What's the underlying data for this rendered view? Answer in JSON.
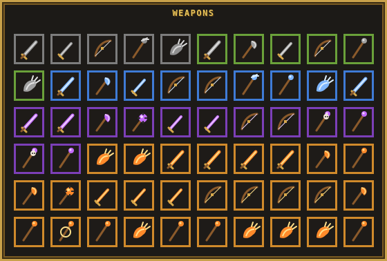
{
  "title": "WEAPONS",
  "rarity_colors": {
    "common": "#7d7d7d",
    "uncommon": "#6aa13a",
    "rare": "#3f7bd6",
    "epic": "#7c3fb8",
    "legendary": "#d08a2b"
  },
  "rows": [
    [
      "gray-sword-icon",
      "gray-dagger-icon",
      "gray-bow-icon",
      "gray-trident-icon",
      "gray-gauntlet-icon",
      "green-sword-icon",
      "green-axe-icon",
      "green-dagger-icon",
      "green-bow-icon",
      "green-staff-icon"
    ],
    [
      "green-claw-gauntlet-icon",
      "blue-sword-icon",
      "blue-halberd-icon",
      "blue-dagger-icon",
      "blue-bow-icon",
      "blue-crossbow-icon",
      "blue-trident-icon",
      "blue-staff-icon",
      "blue-gauntlet-icon",
      "blue-sword-icon"
    ],
    [
      "purple-sword-icon",
      "purple-sword-icon",
      "purple-axe-icon",
      "purple-mace-icon",
      "purple-dagger-icon",
      "purple-scimitar-icon",
      "purple-bow-icon",
      "purple-bow-icon",
      "purple-skull-staff-icon",
      "purple-staff-icon"
    ],
    [
      "purple-skull-staff-icon",
      "purple-staff-icon",
      "orange-gauntlet-icon",
      "orange-gauntlet-icon",
      "orange-sword-icon",
      "orange-sword-icon",
      "orange-sword-icon",
      "orange-sword-icon",
      "orange-axe-icon",
      "orange-staff-icon"
    ],
    [
      "orange-axe-icon",
      "orange-flail-icon",
      "orange-scimitar-icon",
      "orange-scimitar-icon",
      "orange-dagger-icon",
      "orange-bow-icon",
      "orange-bow-icon",
      "orange-bow-icon",
      "orange-bow-icon",
      "orange-axe-icon"
    ],
    [
      "orange-staff-icon",
      "orange-orb-staff-icon",
      "orange-staff-icon",
      "orange-claw-icon",
      "orange-staff-icon",
      "orange-staff-icon",
      "orange-claw-gauntlet-icon",
      "orange-claw-icon",
      "orange-claw-icon",
      "orange-spear-icon"
    ]
  ],
  "row_rarity": [
    [
      "common",
      "common",
      "common",
      "common",
      "common",
      "uncommon",
      "uncommon",
      "uncommon",
      "uncommon",
      "uncommon"
    ],
    [
      "uncommon",
      "rare",
      "rare",
      "rare",
      "rare",
      "rare",
      "rare",
      "rare",
      "rare",
      "rare"
    ],
    [
      "epic",
      "epic",
      "epic",
      "epic",
      "epic",
      "epic",
      "epic",
      "epic",
      "epic",
      "epic"
    ],
    [
      "epic",
      "epic",
      "legendary",
      "legendary",
      "legendary",
      "legendary",
      "legendary",
      "legendary",
      "legendary",
      "legendary"
    ],
    [
      "legendary",
      "legendary",
      "legendary",
      "legendary",
      "legendary",
      "legendary",
      "legendary",
      "legendary",
      "legendary",
      "legendary"
    ],
    [
      "legendary",
      "legendary",
      "legendary",
      "legendary",
      "legendary",
      "legendary",
      "legendary",
      "legendary",
      "legendary",
      "legendary"
    ]
  ]
}
